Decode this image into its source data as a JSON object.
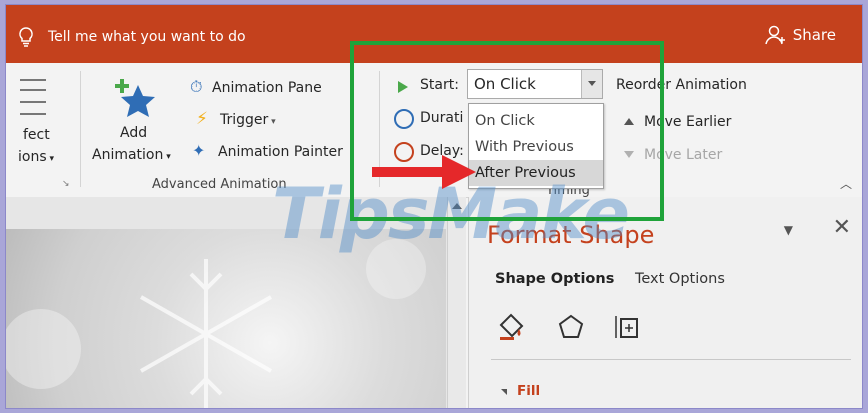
{
  "titlebar": {
    "tell_me": "Tell me what you want to do",
    "share": "Share"
  },
  "ribbon": {
    "effect_options_line1": "fect",
    "effect_options_line2": "ions",
    "add_animation_line1": "Add",
    "add_animation_line2": "Animation",
    "animation_pane": "Animation Pane",
    "trigger": "Trigger",
    "animation_painter": "Animation Painter",
    "group_advanced": "Advanced Animation",
    "start_label": "Start:",
    "start_value": "On Click",
    "duration_label": "Durati",
    "delay_label": "Delay:",
    "timing_group": "Timing",
    "reorder_label": "Reorder Animation",
    "move_earlier": "Move Earlier",
    "move_later": "Move Later"
  },
  "dropdown": {
    "options": [
      "On Click",
      "With Previous",
      "After Previous"
    ],
    "selected_index": 2
  },
  "format_pane": {
    "title": "Format Shape",
    "tab_shape": "Shape Options",
    "tab_text": "Text Options",
    "fill": "Fill"
  },
  "watermark": "TipsMake",
  "colors": {
    "accent": "#c4411d",
    "highlight_box": "#1fa33a",
    "arrow": "#e5282a"
  }
}
